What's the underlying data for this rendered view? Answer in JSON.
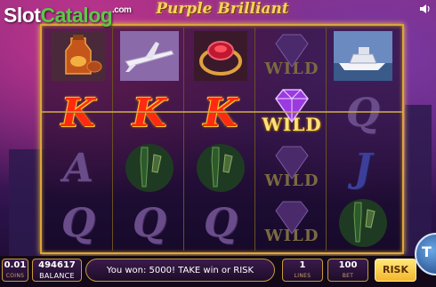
{
  "game": {
    "title": "Purple Brilliant",
    "watermark": {
      "part1": "Slot",
      "part2": "Catalog",
      "suffix": ".com"
    }
  },
  "reels": [
    [
      "cognac",
      "K",
      "A",
      "Q"
    ],
    [
      "jet",
      "K",
      "champagne",
      "Q"
    ],
    [
      "ruby_ring",
      "K",
      "champagne",
      "Q"
    ],
    [
      "wild_diamond",
      "wild_diamond",
      "wild_diamond",
      "wild_diamond"
    ],
    [
      "yacht",
      "Q",
      "J",
      "champagne"
    ]
  ],
  "symbol_text": {
    "K": "K",
    "A": "A",
    "Q": "Q",
    "J": "J",
    "wild": "WILD"
  },
  "controls": {
    "bet": {
      "value": "0.01",
      "label": "COINS"
    },
    "balance": {
      "value": "494617",
      "label": "BALANCE"
    },
    "message": "You won: 5000! TAKE win or RISK",
    "lines": {
      "value": "1",
      "label": "LINES"
    },
    "total_bet": {
      "value": "100",
      "label": "BET"
    },
    "risk_label": "RISK",
    "take_label": "T"
  },
  "colors": {
    "accent_gold": "#d9a63a",
    "background": "#5a1f6e"
  }
}
